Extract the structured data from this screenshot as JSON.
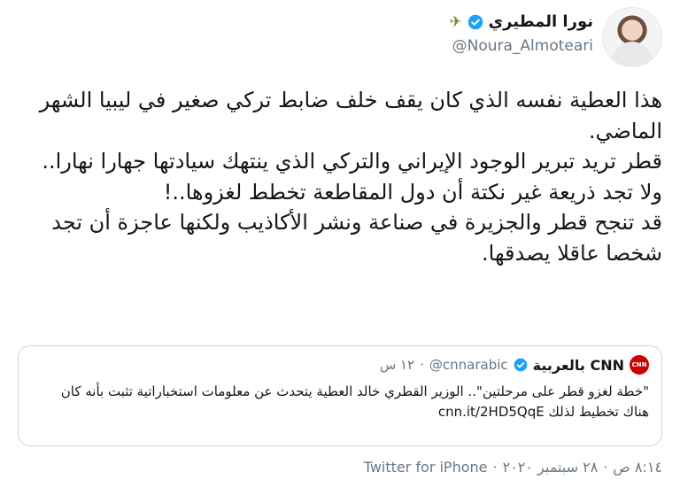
{
  "author": {
    "display_name": "نورا المطيري",
    "handle": "@Noura_Almoteari",
    "name_emoji": "✈",
    "avatar_icon": "profile-photo"
  },
  "tweet": {
    "text": "هذا العطية نفسه الذي كان يقف خلف ضابط تركي صغير في ليبيا الشهر الماضي.\nقطر تريد تبرير الوجود الإيراني والتركي الذي ينتهك سيادتها جهارا نهارا.. ولا تجد ذريعة غير نكتة أن دول المقاطعة تخطط لغزوها..!\nقد تنجح قطر والجزيرة في صناعة ونشر الأكاذيب ولكنها عاجزة أن تجد شخصا عاقلا يصدقها."
  },
  "quoted": {
    "display_name": "CNN بالعربية",
    "logo_text": "CNN",
    "handle": "@cnnarabic",
    "separator": "·",
    "time": "١٢ س",
    "text": "\"خطة لغزو قطر على مرحلتين\".. الوزير القطري خالد العطية يتحدث عن معلومات استخباراتية تثبت بأنه كان هناك تخطيط لذلك",
    "link": "cnn.it/2HD5QqE"
  },
  "footer": {
    "time": "٨:١٤ ص",
    "sep1": "·",
    "date": "٢٨ سبتمبر ٢٠٢٠",
    "sep2": "·",
    "client": "Twitter for iPhone"
  },
  "colors": {
    "verified": "#1da1f2",
    "muted": "#657786",
    "border": "#ccd6dd",
    "cnn_red": "#cc0000"
  }
}
